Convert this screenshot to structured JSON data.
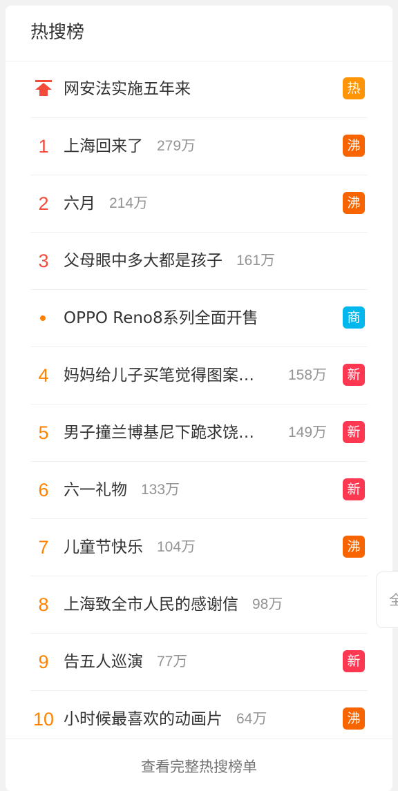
{
  "panel": {
    "title": "热搜榜",
    "footer_link": "查看完整热搜榜单"
  },
  "colors": {
    "hot": "#ff9406",
    "boil": "#f86400",
    "new": "#ff3852",
    "ad": "#00b7ee",
    "rank_top": "#f24a3b",
    "rank": "#ff8200"
  },
  "items": [
    {
      "rank": "",
      "kind": "pinned",
      "title": "网安法实施五年来",
      "count": "",
      "badge": "热",
      "badge_type": "hot",
      "trunc": false
    },
    {
      "rank": "1",
      "kind": "top",
      "title": "上海回来了",
      "count": "279万",
      "badge": "沸",
      "badge_type": "boil",
      "trunc": false
    },
    {
      "rank": "2",
      "kind": "top",
      "title": "六月",
      "count": "214万",
      "badge": "沸",
      "badge_type": "boil",
      "trunc": false
    },
    {
      "rank": "3",
      "kind": "top",
      "title": "父母眼中多大都是孩子",
      "count": "161万",
      "badge": "",
      "badge_type": "",
      "trunc": false
    },
    {
      "rank": "",
      "kind": "ad",
      "title": "OPPO Reno8系列全面开售",
      "count": "",
      "badge": "商",
      "badge_type": "ad",
      "trunc": false
    },
    {
      "rank": "4",
      "kind": "normal",
      "title": "妈妈给儿子买笔觉得图案不对劲",
      "count": "158万",
      "badge": "新",
      "badge_type": "new",
      "trunc": true
    },
    {
      "rank": "5",
      "kind": "normal",
      "title": "男子撞兰博基尼下跪求饶车主回应",
      "count": "149万",
      "badge": "新",
      "badge_type": "new",
      "trunc": true
    },
    {
      "rank": "6",
      "kind": "normal",
      "title": "六一礼物",
      "count": "133万",
      "badge": "新",
      "badge_type": "new",
      "trunc": false
    },
    {
      "rank": "7",
      "kind": "normal",
      "title": "儿童节快乐",
      "count": "104万",
      "badge": "沸",
      "badge_type": "boil",
      "trunc": false
    },
    {
      "rank": "8",
      "kind": "normal",
      "title": "上海致全市人民的感谢信",
      "count": "98万",
      "badge": "",
      "badge_type": "",
      "trunc": false
    },
    {
      "rank": "9",
      "kind": "normal",
      "title": "告五人巡演",
      "count": "77万",
      "badge": "新",
      "badge_type": "new",
      "trunc": false
    },
    {
      "rank": "10",
      "kind": "normal",
      "title": "小时候最喜欢的动画片",
      "count": "64万",
      "badge": "沸",
      "badge_type": "boil",
      "trunc": false
    }
  ],
  "side_tab": {
    "label": "全"
  }
}
